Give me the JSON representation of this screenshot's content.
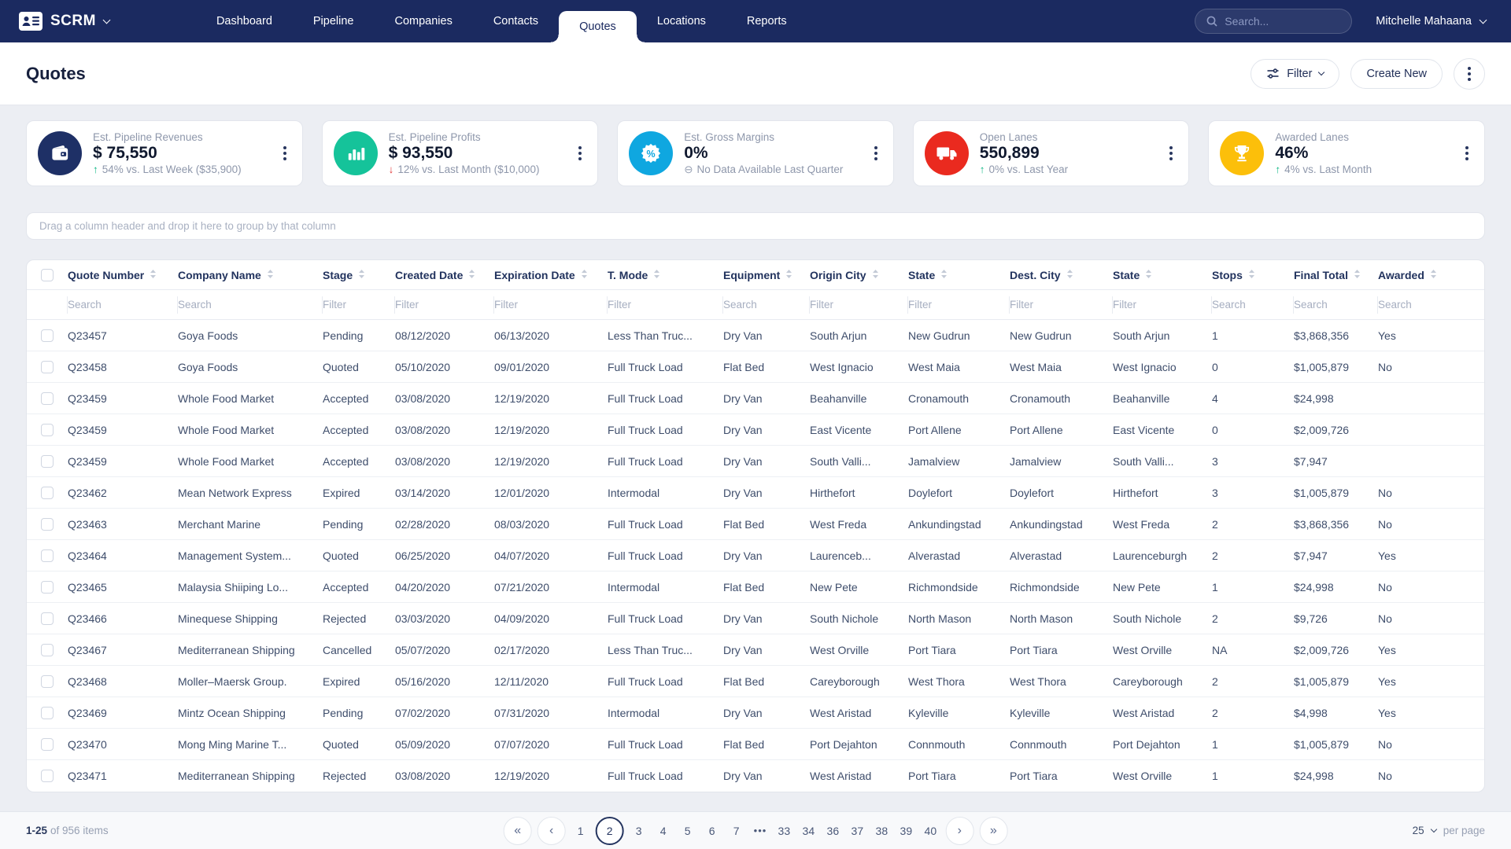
{
  "brand": {
    "name": "SCRM"
  },
  "nav": {
    "items": [
      {
        "label": "Dashboard",
        "active": false
      },
      {
        "label": "Pipeline",
        "active": false
      },
      {
        "label": "Companies",
        "active": false
      },
      {
        "label": "Contacts",
        "active": false
      },
      {
        "label": "Quotes",
        "active": true
      },
      {
        "label": "Locations",
        "active": false
      },
      {
        "label": "Reports",
        "active": false
      }
    ],
    "search_placeholder": "Search...",
    "user": "Mitchelle Mahaana"
  },
  "page": {
    "title": "Quotes",
    "filter_label": "Filter",
    "create_label": "Create New"
  },
  "kpis": [
    {
      "title": "Est. Pipeline Revenues",
      "value": "$ 75,550",
      "trend": "up",
      "arrow": "↑",
      "subtext": "54% vs. Last Week ($35,900)",
      "icon": "wallet",
      "color": "#1e3066"
    },
    {
      "title": "Est. Pipeline Profits",
      "value": "$ 93,550",
      "trend": "down",
      "arrow": "↓",
      "subtext": "12% vs. Last Month ($10,000)",
      "icon": "bar-chart",
      "color": "#15c39a"
    },
    {
      "title": "Est. Gross Margins",
      "value": "0%",
      "trend": "none",
      "arrow": "⊖",
      "subtext": "No Data Available Last Quarter",
      "icon": "percent-badge",
      "color": "#0fa7e0"
    },
    {
      "title": "Open Lanes",
      "value": "550,899",
      "trend": "up",
      "arrow": "↑",
      "subtext": "0% vs. Last Year",
      "icon": "truck",
      "color": "#ea2a1f"
    },
    {
      "title": "Awarded Lanes",
      "value": "46%",
      "trend": "up",
      "arrow": "↑",
      "subtext": "4% vs. Last Month",
      "icon": "trophy",
      "color": "#fcbf0a"
    }
  ],
  "group_bar": {
    "text": "Drag a column header and drop it here to group by that column"
  },
  "table": {
    "columns": [
      {
        "label": "Quote Number",
        "filter": "Search"
      },
      {
        "label": "Company Name",
        "filter": "Search"
      },
      {
        "label": "Stage",
        "filter": "Filter"
      },
      {
        "label": "Created Date",
        "filter": "Filter"
      },
      {
        "label": "Expiration Date",
        "filter": "Filter"
      },
      {
        "label": "T. Mode",
        "filter": "Filter"
      },
      {
        "label": "Equipment",
        "filter": "Search"
      },
      {
        "label": "Origin City",
        "filter": "Filter"
      },
      {
        "label": "State",
        "filter": "Filter"
      },
      {
        "label": "Dest. City",
        "filter": "Filter"
      },
      {
        "label": "State",
        "filter": "Filter"
      },
      {
        "label": "Stops",
        "filter": "Search"
      },
      {
        "label": "Final Total",
        "filter": "Search"
      },
      {
        "label": "Awarded",
        "filter": "Search"
      }
    ],
    "rows": [
      [
        "Q23457",
        "Goya Foods",
        "Pending",
        "08/12/2020",
        "06/13/2020",
        "Less Than Truc...",
        "Dry Van",
        "South Arjun",
        "New Gudrun",
        "New Gudrun",
        "South Arjun",
        "1",
        "$3,868,356",
        "Yes"
      ],
      [
        "Q23458",
        "Goya Foods",
        "Quoted",
        "05/10/2020",
        "09/01/2020",
        "Full Truck Load",
        "Flat Bed",
        "West Ignacio",
        "West Maia",
        "West Maia",
        "West Ignacio",
        "0",
        "$1,005,879",
        "No"
      ],
      [
        "Q23459",
        "Whole Food Market",
        "Accepted",
        "03/08/2020",
        "12/19/2020",
        "Full Truck Load",
        "Dry Van",
        "Beahanville",
        "Cronamouth",
        "Cronamouth",
        "Beahanville",
        "4",
        "$24,998",
        ""
      ],
      [
        "Q23459",
        "Whole Food Market",
        "Accepted",
        "03/08/2020",
        "12/19/2020",
        "Full Truck Load",
        "Dry Van",
        "East Vicente",
        "Port Allene",
        "Port Allene",
        "East Vicente",
        "0",
        "$2,009,726",
        ""
      ],
      [
        "Q23459",
        "Whole Food Market",
        "Accepted",
        "03/08/2020",
        "12/19/2020",
        "Full Truck Load",
        "Dry Van",
        "South Valli...",
        "Jamalview",
        "Jamalview",
        "South Valli...",
        "3",
        "$7,947",
        ""
      ],
      [
        "Q23462",
        "Mean Network Express",
        "Expired",
        "03/14/2020",
        "12/01/2020",
        "Intermodal",
        "Dry Van",
        "Hirthefort",
        "Doylefort",
        "Doylefort",
        "Hirthefort",
        "3",
        "$1,005,879",
        "No"
      ],
      [
        "Q23463",
        "Merchant Marine",
        "Pending",
        "02/28/2020",
        "08/03/2020",
        "Full Truck Load",
        "Flat Bed",
        "West Freda",
        "Ankundingstad",
        "Ankundingstad",
        "West Freda",
        "2",
        "$3,868,356",
        "No"
      ],
      [
        "Q23464",
        "Management System...",
        "Quoted",
        "06/25/2020",
        "04/07/2020",
        "Full Truck Load",
        "Dry Van",
        "Laurenceb...",
        "Alverastad",
        "Alverastad",
        "Laurenceburgh",
        "2",
        "$7,947",
        "Yes"
      ],
      [
        "Q23465",
        "Malaysia Shiiping Lo...",
        "Accepted",
        "04/20/2020",
        "07/21/2020",
        "Intermodal",
        "Flat Bed",
        "New Pete",
        "Richmondside",
        "Richmondside",
        "New Pete",
        "1",
        "$24,998",
        "No"
      ],
      [
        "Q23466",
        "Minequese Shipping",
        "Rejected",
        "03/03/2020",
        "04/09/2020",
        "Full Truck Load",
        "Dry Van",
        "South Nichole",
        "North Mason",
        "North Mason",
        "South Nichole",
        "2",
        "$9,726",
        "No"
      ],
      [
        "Q23467",
        "Mediterranean Shipping",
        "Cancelled",
        "05/07/2020",
        "02/17/2020",
        "Less Than Truc...",
        "Dry Van",
        "West Orville",
        "Port Tiara",
        "Port Tiara",
        "West Orville",
        "NA",
        "$2,009,726",
        "Yes"
      ],
      [
        "Q23468",
        "Moller–Maersk Group.",
        "Expired",
        "05/16/2020",
        "12/11/2020",
        "Full Truck Load",
        "Flat Bed",
        "Careyborough",
        "West Thora",
        "West Thora",
        "Careyborough",
        "2",
        "$1,005,879",
        "Yes"
      ],
      [
        "Q23469",
        "Mintz Ocean Shipping",
        "Pending",
        "07/02/2020",
        "07/31/2020",
        "Intermodal",
        "Dry Van",
        "West Aristad",
        "Kyleville",
        "Kyleville",
        "West Aristad",
        "2",
        "$4,998",
        "Yes"
      ],
      [
        "Q23470",
        "Mong Ming Marine T...",
        "Quoted",
        "05/09/2020",
        "07/07/2020",
        "Full Truck Load",
        "Flat Bed",
        "Port Dejahton",
        "Connmouth",
        "Connmouth",
        "Port Dejahton",
        "1",
        "$1,005,879",
        "No"
      ],
      [
        "Q23471",
        "Mediterranean Shipping",
        "Rejected",
        "03/08/2020",
        "12/19/2020",
        "Full Truck Load",
        "Dry Van",
        "West Aristad",
        "Port Tiara",
        "Port Tiara",
        "West Orville",
        "1",
        "$24,998",
        "No"
      ]
    ]
  },
  "pagination": {
    "range": "1-25",
    "items_text": "of 956 items",
    "first": "«",
    "prev": "‹",
    "next": "›",
    "last": "»",
    "pages": [
      "1",
      "2",
      "3",
      "4",
      "5",
      "6",
      "7",
      "•••",
      "33",
      "34",
      "36",
      "37",
      "38",
      "39",
      "40"
    ],
    "active": "2",
    "per_page": "25",
    "per_page_label": "per page"
  }
}
